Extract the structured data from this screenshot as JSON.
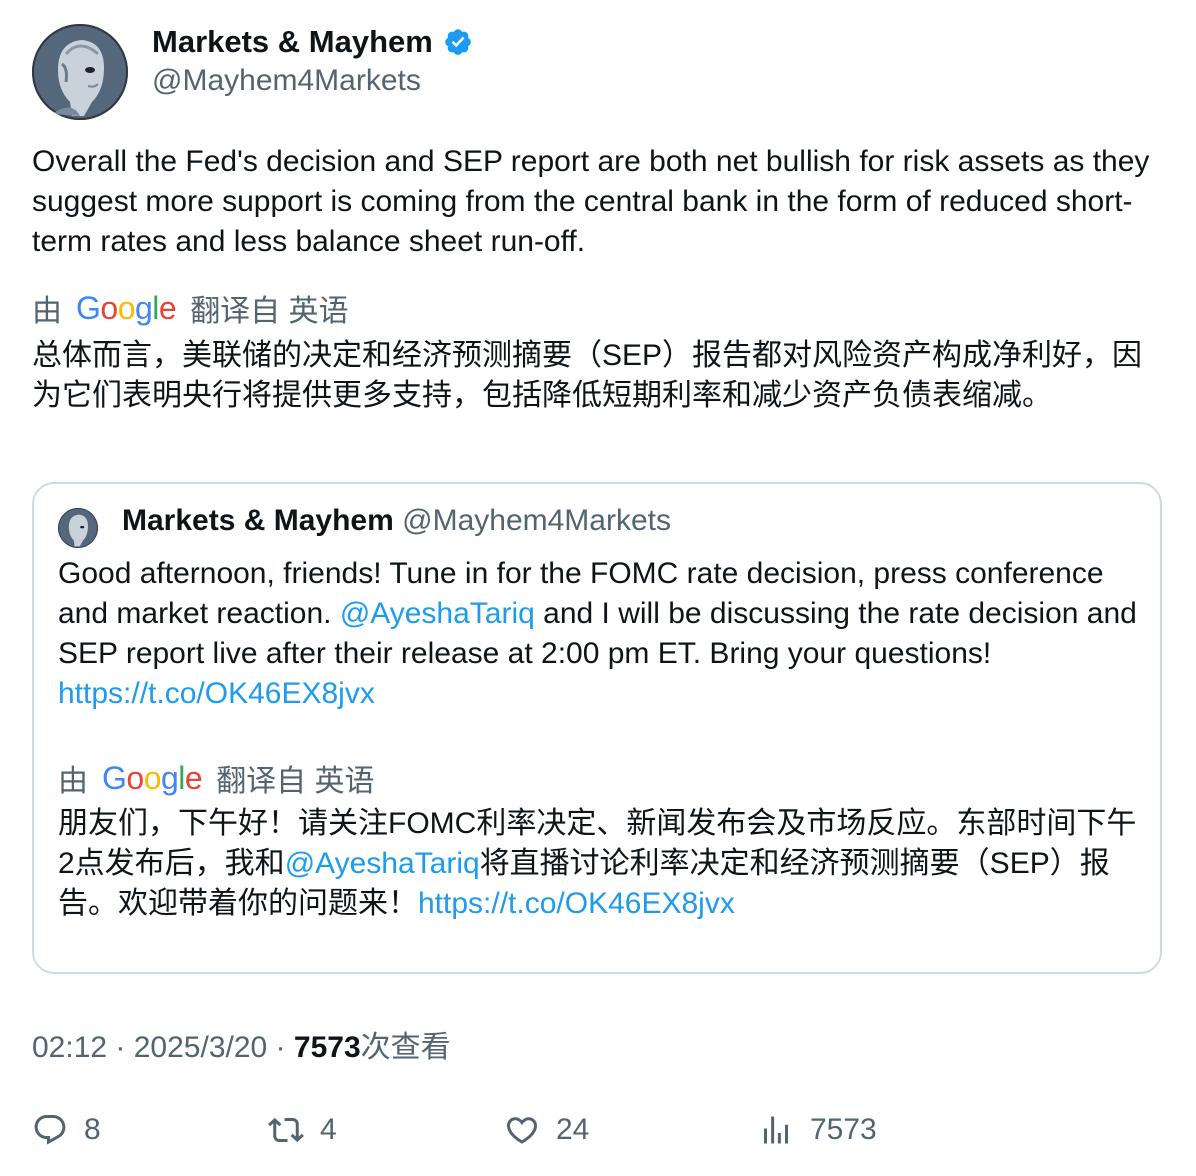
{
  "author": {
    "display_name": "Markets & Mayhem",
    "handle": "@Mayhem4Markets",
    "verified_icon": "verified-badge-icon",
    "badge_color": "#1d9bf0"
  },
  "tweet": {
    "text": "Overall the Fed's decision and SEP report are both net bullish for risk assets as they suggest more support is coming from the central bank in the form of reduced short-term rates and less balance sheet run-off.",
    "translate_prefix": "由",
    "translate_logo": "Google",
    "translate_suffix": "翻译自 英语",
    "translated_text": "总体而言，美联储的决定和经济预测摘要（SEP）报告都对风险资产构成净利好，因为它们表明央行将提供更多支持，包括降低短期利率和减少资产负债表缩减。"
  },
  "quoted": {
    "display_name": "Markets & Mayhem",
    "handle": "@Mayhem4Markets",
    "text_part1": "Good afternoon, friends! Tune in for the FOMC rate decision, press conference and market reaction. ",
    "mention": "@AyeshaTariq",
    "text_part2": " and I will be discussing the rate decision and SEP report live after their release at 2:00 pm ET. Bring your questions! ",
    "link": "https://t.co/OK46EX8jvx",
    "translate_prefix": "由",
    "translate_logo": "Google",
    "translate_suffix": "翻译自 英语",
    "translated_part1": "朋友们，下午好！请关注FOMC利率决定、新闻发布会及市场反应。东部时间下午2点发布后，我和",
    "translated_mention": "@AyeshaTariq",
    "translated_part2": "将直播讨论利率决定和经济预测摘要（SEP）报告。欢迎带着你的问题来！",
    "translated_link": "https://t.co/OK46EX8jvx"
  },
  "meta": {
    "time": "02:12",
    "sep": " · ",
    "date": "2025/3/20",
    "views_count": "7573",
    "views_label": "次查看"
  },
  "actions": {
    "replies": "8",
    "retweets": "4",
    "likes": "24",
    "views": "7573"
  },
  "colors": {
    "text": "#0f1419",
    "secondary": "#536471",
    "link": "#1d9bf0",
    "border": "#cfd9de"
  }
}
